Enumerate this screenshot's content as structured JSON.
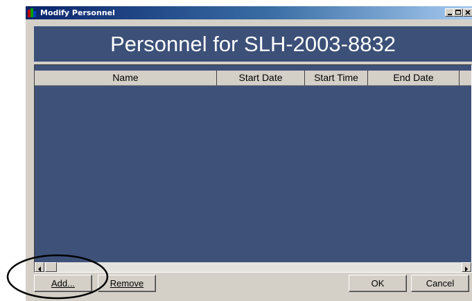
{
  "window": {
    "title": "Modify Personnel",
    "controls": [
      "minimize-icon",
      "maximize-icon",
      "close-icon"
    ]
  },
  "banner": {
    "text": "Personnel for SLH-2003-8832"
  },
  "table": {
    "columns": [
      "Name",
      "Start Date",
      "Start Time",
      "End Date"
    ],
    "rows": []
  },
  "buttons": {
    "add": "Add...",
    "remove": "Remove",
    "ok": "OK",
    "cancel": "Cancel"
  },
  "colors": {
    "banner_bg": "#3c5078",
    "grid_bg": "#3e5179",
    "dialog_bg": "#d4d0c8",
    "annotation": "#000000"
  }
}
